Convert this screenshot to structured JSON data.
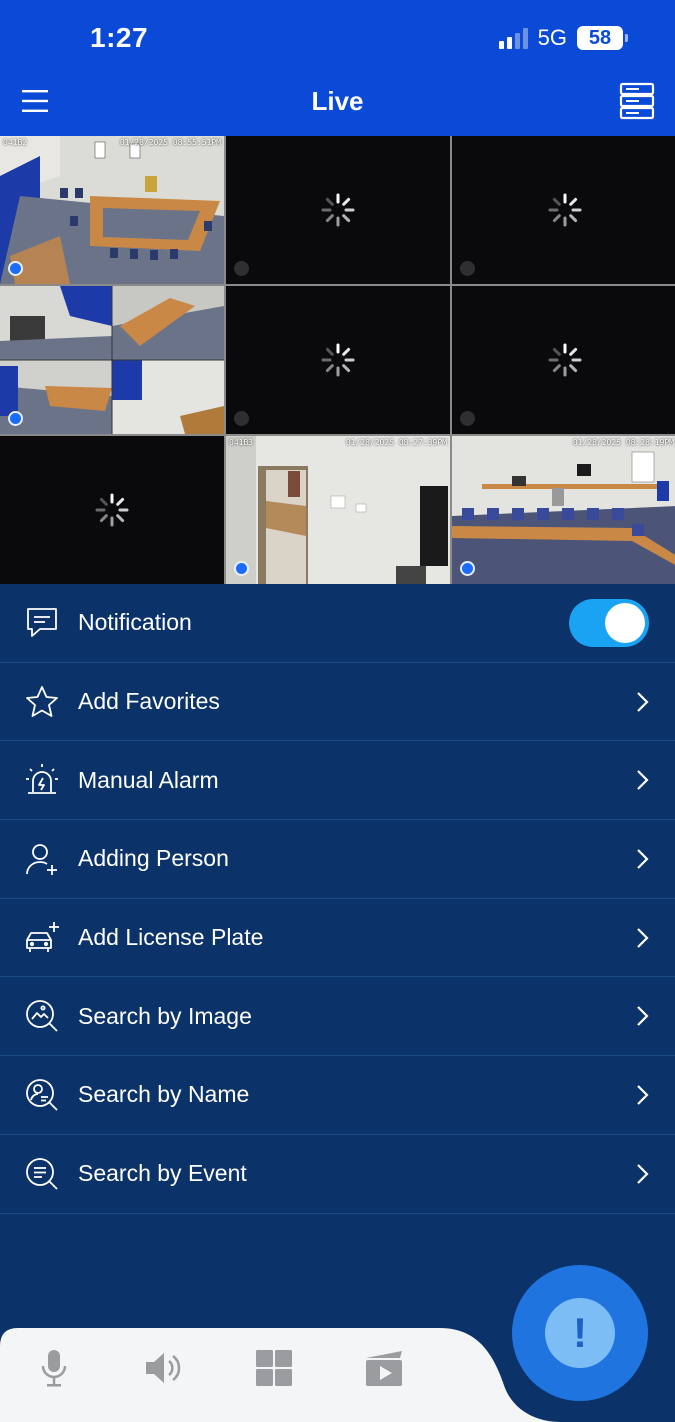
{
  "status_bar": {
    "time": "1:27",
    "network": "5G",
    "battery": "58"
  },
  "header": {
    "title": "Live",
    "menu_icon": "hamburger-icon",
    "devices_icon": "device-list-icon"
  },
  "camera_grid": {
    "tiles": [
      {
        "state": "live",
        "selected": true,
        "overlay_left": "041B2",
        "overlay_right": "01/28/2025 08:55:51PM"
      },
      {
        "state": "loading"
      },
      {
        "state": "loading"
      },
      {
        "state": "live",
        "overlay_left": "",
        "overlay_right": ""
      },
      {
        "state": "loading"
      },
      {
        "state": "loading"
      },
      {
        "state": "loading"
      },
      {
        "state": "live",
        "overlay_left": "041B3",
        "overlay_right": "01/28/2025 08:27:39PM"
      },
      {
        "state": "live",
        "overlay_left": "",
        "overlay_right": "01/28/2025 08:28:19PM"
      }
    ]
  },
  "menu": {
    "items": [
      {
        "label": "Notification",
        "icon": "message-icon",
        "control": "toggle",
        "toggle_on": true
      },
      {
        "label": "Add Favorites",
        "icon": "star-icon"
      },
      {
        "label": "Manual Alarm",
        "icon": "siren-icon"
      },
      {
        "label": "Adding Person",
        "icon": "add-person-icon"
      },
      {
        "label": "Add License Plate",
        "icon": "car-plus-icon"
      },
      {
        "label": "Search by Image",
        "icon": "image-search-icon"
      },
      {
        "label": "Search by Name",
        "icon": "person-search-icon"
      },
      {
        "label": "Search by Event",
        "icon": "event-search-icon"
      }
    ]
  },
  "bottom_bar": {
    "buttons": [
      "microphone-icon",
      "speaker-icon",
      "grid-layout-icon",
      "playback-icon"
    ],
    "fab": {
      "glyph": "!",
      "icon": "alert-icon"
    }
  },
  "colors": {
    "header": "#0a4ad6",
    "background": "#0b3369",
    "toggle": "#1aa3f3",
    "selected_tile": "#29a9e8"
  }
}
